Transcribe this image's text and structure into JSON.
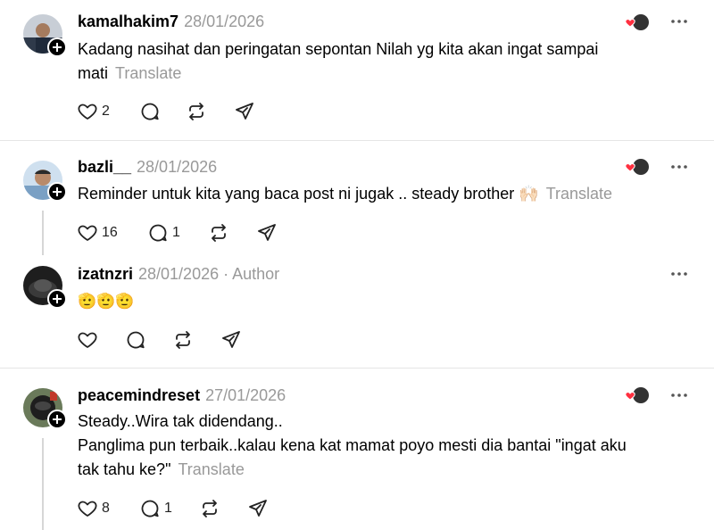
{
  "comments": [
    {
      "username": "kamalhakim7",
      "date": "28/01/2026",
      "text_lines": [
        "Kadang nasihat dan peringatan sepontan Nilah yg kita akan ingat sampai",
        "mati"
      ],
      "translate": "Translate",
      "likes": "2",
      "replies": "",
      "avatar_color": "#4a6f9a"
    },
    {
      "username": "bazli__",
      "date": "28/01/2026",
      "text_lines": [
        "Reminder untuk kita yang baca post ni jugak .. steady brother 🙌🏻"
      ],
      "translate": "Translate",
      "likes": "16",
      "replies": "1",
      "avatar_color": "#7aa0c4"
    },
    {
      "username": "izatnzri",
      "date": "28/01/2026",
      "author_tag": "· Author",
      "text_lines": [
        "🫡🫡🫡"
      ],
      "likes": "",
      "replies": "",
      "avatar_color": "#2a2a2a"
    },
    {
      "username": "peacemindreset",
      "date": "27/01/2026",
      "text_lines": [
        "Steady..Wira tak didendang..",
        "Panglima pun terbaik..kalau kena kat mamat poyo mesti dia bantai \"ingat aku",
        "tak tahu ke?\""
      ],
      "translate": "Translate",
      "likes": "8",
      "replies": "1",
      "avatar_color": "#3d4a3a"
    }
  ],
  "colors": {
    "muted": "#999999",
    "heart": "#ff3040",
    "divider": "#e5e5e5"
  },
  "icons": [
    "heart-icon",
    "comment-icon",
    "repost-icon",
    "share-icon",
    "more-icon",
    "follow-plus-icon"
  ]
}
